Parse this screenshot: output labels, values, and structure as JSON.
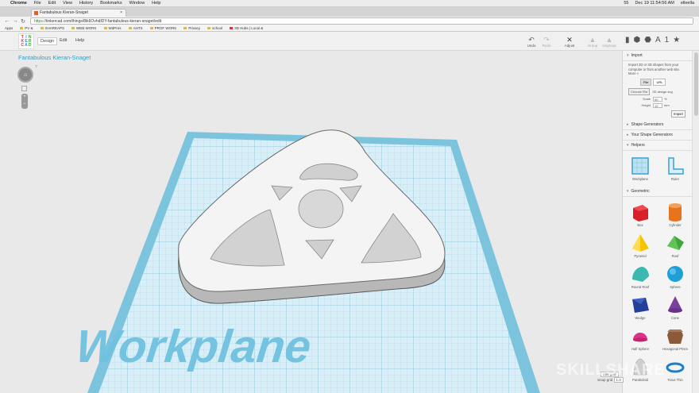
{
  "mac": {
    "apple": "",
    "app": "Chrome",
    "menus": [
      "File",
      "Edit",
      "View",
      "History",
      "Bookmarks",
      "Window",
      "Help"
    ],
    "status": [
      "55",
      "Dec 19  11:54:56 AM",
      "elleella"
    ]
  },
  "tab": {
    "title": "Fantabulous Kieran-Snaget",
    "close": "×"
  },
  "address": {
    "scheme": "https://",
    "rest": "tinkercad.com/things/8ik6OvhdIDY-fantabulous-kieran-snaget/edit",
    "back": "←",
    "fwd": "→",
    "reload": "↻"
  },
  "bookmarks": [
    "Apps",
    "PV &",
    "SHAREAPS",
    "WEB WORK",
    "WdPres",
    "AHTS",
    "PROF WORK",
    "Privacy",
    "school",
    "3D Hubs | Local &"
  ],
  "header": {
    "logo": [
      "T",
      "I",
      "N",
      "K",
      "E",
      "R",
      "C",
      "A",
      "D"
    ],
    "menus": [
      "Design",
      "Edit",
      "Help"
    ],
    "tools": [
      {
        "label": "Undo",
        "icon": "↶"
      },
      {
        "label": "Redo",
        "icon": "↷"
      },
      {
        "label": "Adjust",
        "icon": "✕"
      },
      {
        "label": "Group",
        "icon": "▲"
      },
      {
        "label": "Ungroup",
        "icon": "▲"
      }
    ],
    "view_icons": [
      "▮",
      "⬢",
      "⬣",
      "A",
      "1",
      "★"
    ]
  },
  "design_title": "Fantabulous Kieran-Snaget",
  "viewport": {
    "nav_center": "⌂",
    "zoom_plus": "+",
    "zoom_minus": "−",
    "help": "?",
    "workplane_text": "Workplane"
  },
  "panel": {
    "import": {
      "heading": "Import",
      "desc": [
        "Import 2D or 3D shapes from your",
        "computer or from another web site.",
        "More »"
      ],
      "file_btn": "File",
      "url_btn": "URL",
      "choose": "Choose File",
      "file_status": "3D design.svg",
      "scale_label": "Scale",
      "scale_value": "50",
      "scale_unit": "%",
      "height_label": "Height",
      "height_value": "10",
      "height_unit": "mm",
      "import_btn": "Import"
    },
    "sections": [
      "Shape Generators",
      "Your Shape Generators",
      "Helpers"
    ],
    "helpers": [
      "Workplane",
      "Ruler"
    ],
    "geometric": {
      "heading": "Geometric",
      "shapes": [
        {
          "name": "Box",
          "color": "#d9202a"
        },
        {
          "name": "Cylinder",
          "color": "#e8731e"
        },
        {
          "name": "Pyramid",
          "color": "#f5c400"
        },
        {
          "name": "Roof",
          "color": "#3fa63a"
        },
        {
          "name": "Round Roof",
          "color": "#3bb8b0"
        },
        {
          "name": "Sphere",
          "color": "#1ea0d6"
        },
        {
          "name": "Wedge",
          "color": "#233f99"
        },
        {
          "name": "Cone",
          "color": "#7b3f9e"
        },
        {
          "name": "Half Sphere",
          "color": "#e0308a"
        },
        {
          "name": "Hexagonal Prism",
          "color": "#8a5a3a"
        },
        {
          "name": "Paraboloid",
          "color": "#cfcfcf"
        },
        {
          "name": "Torus Thin",
          "color": "#1c7fcc"
        }
      ]
    }
  },
  "snap": {
    "edit_grid": "Edit grid",
    "snap_label": "Snap grid",
    "snap_value": "1.0"
  },
  "watermark": "SKILLSHARE"
}
